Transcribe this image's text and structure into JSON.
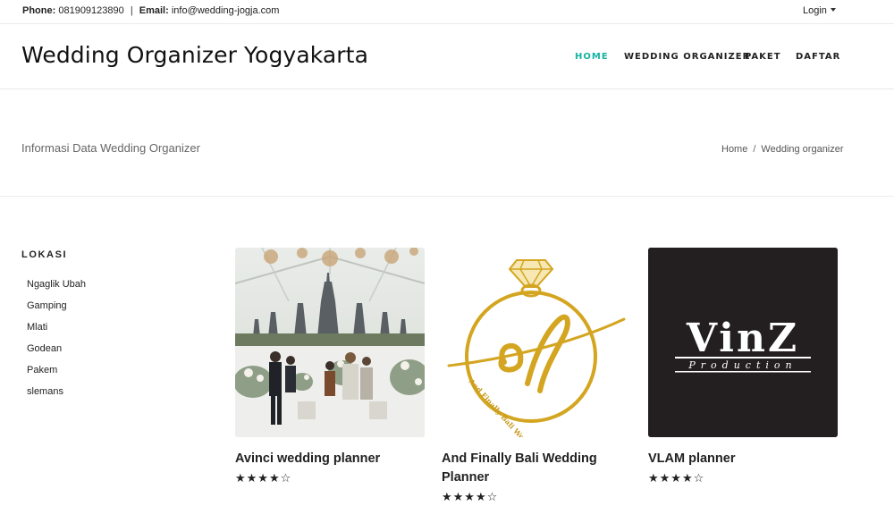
{
  "topbar": {
    "phone_label": "Phone:",
    "phone_value": "081909123890",
    "separator": "|",
    "email_label": "Email:",
    "email_value": "info@wedding-jogja.com",
    "login_label": "Login"
  },
  "header": {
    "title": "Wedding Organizer Yogyakarta",
    "nav": [
      {
        "label": "HOME",
        "active": true
      },
      {
        "label": "WEDDING ORGANIZER",
        "active": false
      },
      {
        "label": "PAKET",
        "active": false
      },
      {
        "label": "DAFTAR",
        "active": false
      }
    ]
  },
  "page": {
    "subtitle": "Informasi Data Wedding Organizer",
    "breadcrumb": {
      "home": "Home",
      "separator": "/",
      "current": "Wedding organizer"
    }
  },
  "sidebar": {
    "title": "LOKASI",
    "items": [
      "Ngaglik Ubah",
      "Gamping",
      "Mlati",
      "Godean",
      "Pakem",
      "slemans"
    ]
  },
  "cards": [
    {
      "name": "Avinci wedding planner",
      "rating": 4,
      "max_rating": 5,
      "stars_text": "★★★★☆"
    },
    {
      "name": "And Finally Bali Wedding Planner",
      "rating": 4,
      "max_rating": 5,
      "stars_text": "★★★★☆",
      "logo_text": "af",
      "logo_ring_text": "And Finally Bali Wedding Planner"
    },
    {
      "name": "VLAM planner",
      "rating": 4,
      "max_rating": 5,
      "stars_text": "★★★★☆",
      "logo_text": "VinZ",
      "logo_sub": "Production"
    }
  ],
  "colors": {
    "accent": "#17b3a3",
    "gold": "#d4a520",
    "dark_card": "#231f20"
  }
}
